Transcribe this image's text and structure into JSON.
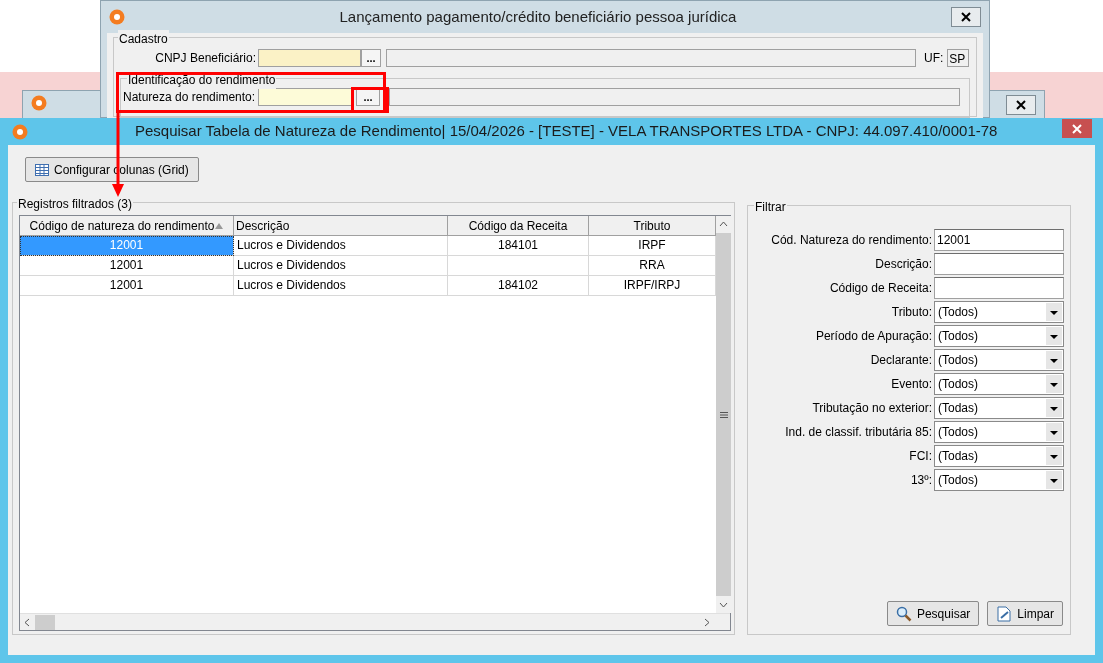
{
  "main_dialog": {
    "title": "Lançamento pagamento/crédito beneficiário pessoa jurídica",
    "cadastro": {
      "title": "Cadastro",
      "cnpj_label": "CNPJ Beneficiário:",
      "lookup_button": "...",
      "uf_label": "UF:",
      "uf_value": "SP"
    },
    "identificacao": {
      "title": "Identificação do rendimento",
      "natureza_label": "Natureza do rendimento:",
      "lookup_button": "..."
    }
  },
  "search_window": {
    "title": "Pesquisar Tabela de Natureza de Rendimento|  15/04/2026 - [TESTE] - VELA TRANSPORTES LTDA - CNPJ: 44.097.410/0001-78",
    "toolbar_button": "Configurar colunas (Grid)",
    "grid": {
      "title": "Registros filtrados (3)",
      "columns": [
        "Código de natureza do rendimento",
        "Descrição",
        "Código da Receita",
        "Tributo"
      ],
      "rows": [
        {
          "cells": [
            "12001",
            "Lucros e Dividendos",
            "184101",
            "IRPF"
          ],
          "selected": true
        },
        {
          "cells": [
            "12001",
            "Lucros e Dividendos",
            "",
            "RRA"
          ],
          "selected": false
        },
        {
          "cells": [
            "12001",
            "Lucros e Dividendos",
            "184102",
            "IRPF/IRPJ"
          ],
          "selected": false
        }
      ]
    },
    "filter": {
      "title": "Filtrar",
      "fields": [
        {
          "kind": "text",
          "label": "Cód. Natureza do rendimento:",
          "value": "12001"
        },
        {
          "kind": "text",
          "label": "Descrição:"
        },
        {
          "kind": "text",
          "label": "Código de Receita:"
        },
        {
          "kind": "select",
          "label": "Tributo:",
          "value": "(Todos)"
        },
        {
          "kind": "select",
          "label": "Período de Apuração:",
          "value": "(Todos)"
        },
        {
          "kind": "select",
          "label": "Declarante:",
          "value": "(Todos)"
        },
        {
          "kind": "select",
          "label": "Evento:",
          "value": "(Todos)"
        },
        {
          "kind": "select",
          "label": "Tributação no exterior:",
          "value": "(Todas)"
        },
        {
          "kind": "select",
          "label": "Ind. de classif. tributária 85:",
          "value": "(Todos)"
        },
        {
          "kind": "select",
          "label": "FCI:",
          "value": "(Todas)"
        },
        {
          "kind": "select",
          "label": "13º:",
          "value": "(Todos)"
        }
      ]
    },
    "buttons": [
      {
        "kind": "search",
        "label": "Pesquisar"
      },
      {
        "kind": "clear",
        "label": "Limpar"
      }
    ]
  }
}
